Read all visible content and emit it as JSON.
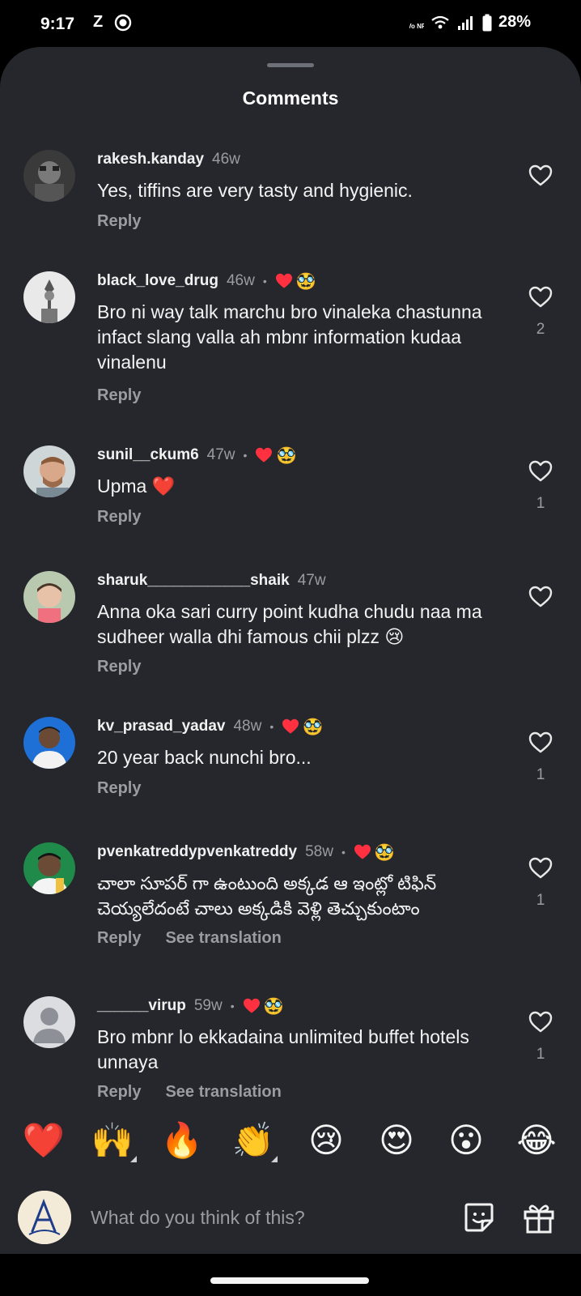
{
  "status_bar": {
    "time": "9:17",
    "carrier_letter": "Z",
    "network_label": "Vo NR",
    "battery": "28%"
  },
  "sheet": {
    "title": "Comments"
  },
  "colors": {
    "heart_red": "#ff3040",
    "sheet_bg": "#25272c",
    "muted_text": "#9a9ca2"
  },
  "comments": [
    {
      "username": "rakesh.kanday",
      "time": "46w",
      "creator_liked": false,
      "text": "Yes, tiffins are very tasty and hygienic.",
      "reply_label": "Reply",
      "see_translation": "",
      "likes": ""
    },
    {
      "username": "black_love_drug",
      "time": "46w",
      "creator_liked": true,
      "text": "Bro ni way talk marchu bro vinaleka chastunna infact  slang valla ah mbnr information kudaa vinalenu",
      "reply_label": "Reply",
      "see_translation": "",
      "likes": "2"
    },
    {
      "username": "sunil__ckum6",
      "time": "47w",
      "creator_liked": true,
      "text": "Upma ❤️",
      "reply_label": "Reply",
      "see_translation": "",
      "likes": "1"
    },
    {
      "username": "sharuk____________shaik",
      "time": "47w",
      "creator_liked": false,
      "text": "Anna oka sari curry point kudha chudu naa ma sudheer walla dhi famous chii plzz 😢",
      "reply_label": "Reply",
      "see_translation": "",
      "likes": ""
    },
    {
      "username": "kv_prasad_yadav",
      "time": "48w",
      "creator_liked": true,
      "text": "20 year back nunchi bro...",
      "reply_label": "Reply",
      "see_translation": "",
      "likes": "1"
    },
    {
      "username": "pvenkatreddypvenkatreddy",
      "time": "58w",
      "creator_liked": true,
      "text": "చాలా సూపర్ గా ఉంటుంది అక్కడ ఆ ఇంట్లో టిఫిన్ చెయ్యలేదంటే చాలు అక్కడికి వెళ్లి తెచ్చుకుంటాం",
      "reply_label": "Reply",
      "see_translation": "See translation",
      "likes": "1"
    },
    {
      "username": "______virup",
      "time": "59w",
      "creator_liked": true,
      "text": "Bro mbnr lo ekkadaina unlimited buffet hotels unnaya",
      "reply_label": "Reply",
      "see_translation": "See translation",
      "likes": "1"
    }
  ],
  "emoji_bar": [
    "❤️",
    "🙌",
    "🔥",
    "👏",
    "😢",
    "😍",
    "😮",
    "😂"
  ],
  "composer": {
    "placeholder": "What do you think of this?"
  }
}
